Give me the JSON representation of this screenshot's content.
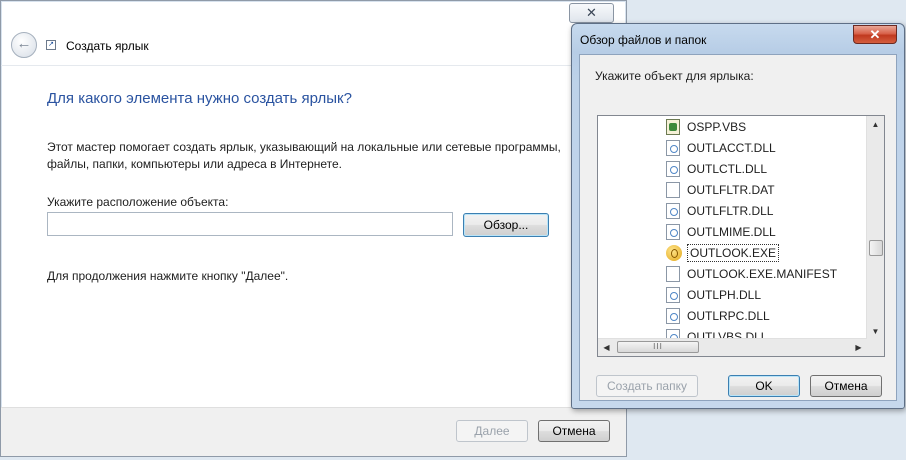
{
  "wizard": {
    "close_glyph": "✕",
    "back_icon": "back-arrow-icon",
    "header_title": "Создать ярлык",
    "heading": "Для какого элемента нужно создать ярлык?",
    "description": "Этот мастер помогает создать ярлык, указывающий на локальные или сетевые программы, файлы, папки, компьютеры или адреса в Интернете.",
    "location_label": "Укажите расположение объекта:",
    "location_value": "",
    "browse_label": "Обзор...",
    "hint": "Для продолжения нажмите кнопку \"Далее\".",
    "next_label": "Далее",
    "cancel_label": "Отмена"
  },
  "browse_dialog": {
    "title": "Обзор файлов и папок",
    "close_glyph": "✕",
    "prompt": "Укажите объект для ярлыка:",
    "files": [
      {
        "name": "OSPP.VBS",
        "icon": "vbs-script-icon"
      },
      {
        "name": "OUTLACCT.DLL",
        "icon": "dll-file-icon"
      },
      {
        "name": "OUTLCTL.DLL",
        "icon": "dll-file-icon"
      },
      {
        "name": "OUTLFLTR.DAT",
        "icon": "blank-file-icon"
      },
      {
        "name": "OUTLFLTR.DLL",
        "icon": "dll-file-icon"
      },
      {
        "name": "OUTLMIME.DLL",
        "icon": "dll-file-icon"
      },
      {
        "name": "OUTLOOK.EXE",
        "icon": "outlook-app-icon",
        "selected": true
      },
      {
        "name": "OUTLOOK.EXE.MANIFEST",
        "icon": "blank-file-icon"
      },
      {
        "name": "OUTLPH.DLL",
        "icon": "dll-file-icon"
      },
      {
        "name": "OUTLRPC.DLL",
        "icon": "dll-file-icon"
      },
      {
        "name": "OUTLVBS.DLL",
        "icon": "dll-file-icon"
      }
    ],
    "scroll_thumb_grip": "III",
    "new_folder_label": "Создать папку",
    "ok_label": "OK",
    "cancel_label": "Отмена"
  },
  "colors": {
    "heading": "#2a53a0",
    "close_button": "#c7402b",
    "dialog_frame": "#bdd2e9"
  }
}
